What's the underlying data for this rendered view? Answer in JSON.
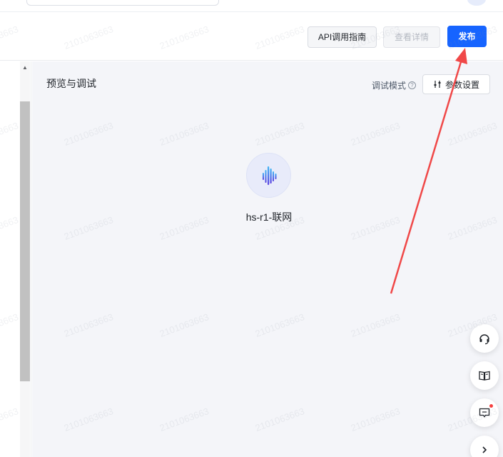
{
  "header": {
    "api_guide_label": "API调用指南",
    "view_details_label": "查看详情",
    "publish_label": "发布"
  },
  "preview": {
    "title": "预览与调试",
    "debug_mode_label": "调试模式",
    "params_label": "参数设置",
    "bot_name": "hs-r1-联网"
  },
  "watermark": {
    "text": "2101063663"
  },
  "icons": {
    "help": "help-circle-icon",
    "params": "sliders-icon",
    "bot": "voice-wave-icon",
    "support": "headset-icon",
    "docs": "book-icon",
    "feedback": "feedback-icon",
    "next": "chevron-right-icon"
  },
  "colors": {
    "primary": "#1664ff",
    "annotation_arrow": "#f04848",
    "panel_bg": "#f4f5f9",
    "notification_dot": "#f53f3f"
  }
}
